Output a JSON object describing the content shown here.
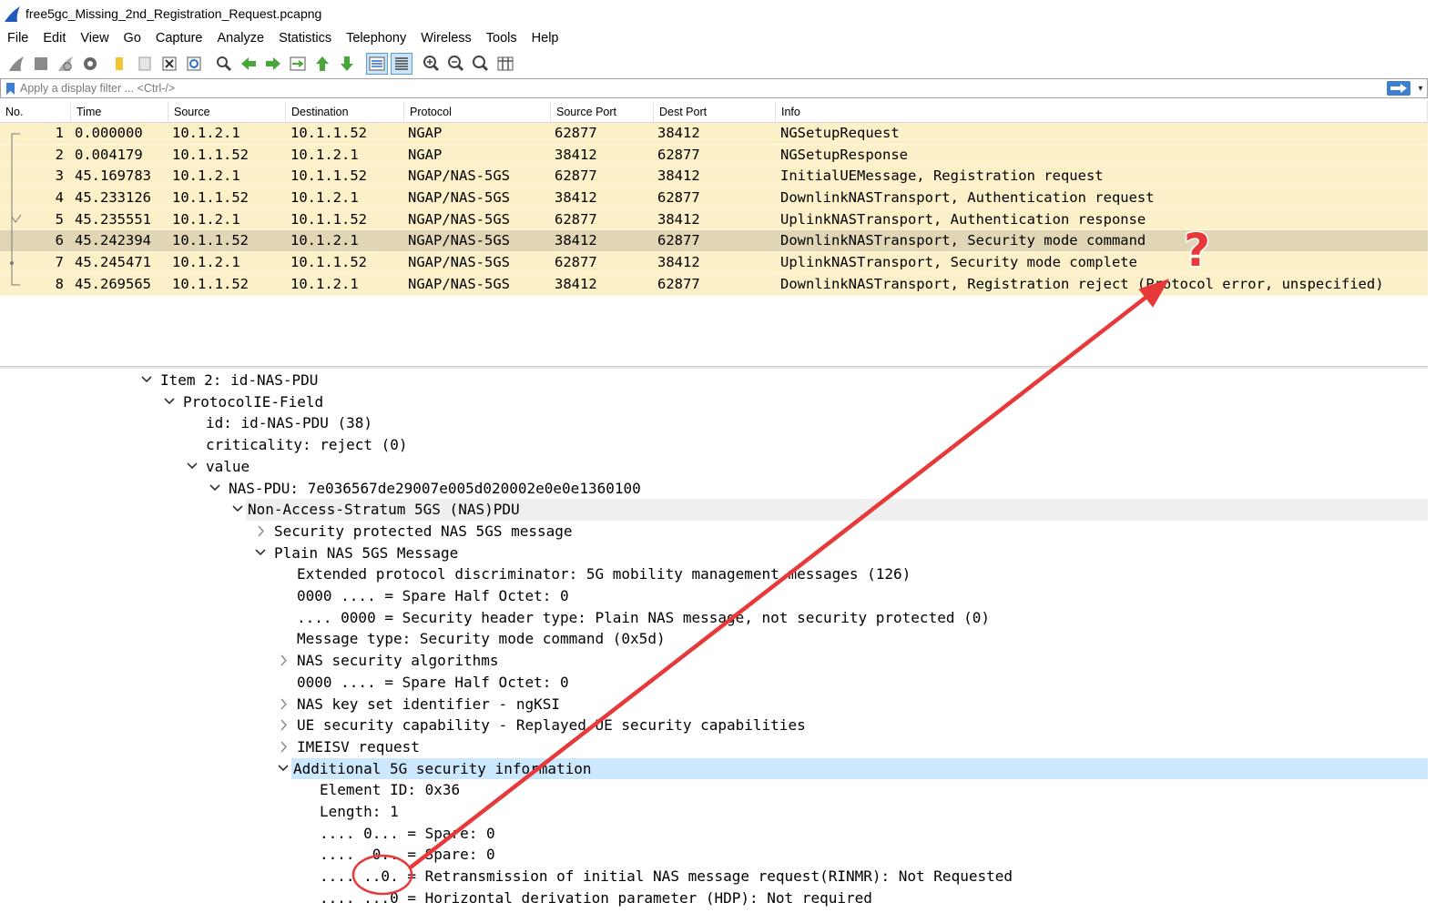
{
  "window": {
    "title": "free5gc_Missing_2nd_Registration_Request.pcapng"
  },
  "menu": [
    "File",
    "Edit",
    "View",
    "Go",
    "Capture",
    "Analyze",
    "Statistics",
    "Telephony",
    "Wireless",
    "Tools",
    "Help"
  ],
  "toolbar": {
    "icons": [
      "shark-fin-start-icon",
      "stop-icon",
      "restart-icon",
      "capture-options-icon",
      "open-file-icon",
      "save-file-icon",
      "close-file-icon",
      "reload-icon",
      "find-packet-icon",
      "go-back-icon",
      "go-forward-icon",
      "go-to-packet-icon",
      "first-packet-icon",
      "last-packet-icon",
      "autoscroll-icon",
      "colorize-icon",
      "zoom-in-icon",
      "zoom-out-icon",
      "zoom-normal-icon",
      "resize-columns-icon"
    ]
  },
  "filter": {
    "placeholder": "Apply a display filter ... <Ctrl-/>"
  },
  "packet_list": {
    "columns": [
      "No.",
      "Time",
      "Source",
      "Destination",
      "Protocol",
      "Source Port",
      "Dest Port",
      "Info"
    ],
    "rows": [
      {
        "no": "1",
        "time": "0.000000",
        "source": "10.1.2.1",
        "destination": "10.1.1.52",
        "protocol": "NGAP",
        "sport": "62877",
        "dport": "38412",
        "info": "NGSetupRequest",
        "selected": false
      },
      {
        "no": "2",
        "time": "0.004179",
        "source": "10.1.1.52",
        "destination": "10.1.2.1",
        "protocol": "NGAP",
        "sport": "38412",
        "dport": "62877",
        "info": "NGSetupResponse",
        "selected": false
      },
      {
        "no": "3",
        "time": "45.169783",
        "source": "10.1.2.1",
        "destination": "10.1.1.52",
        "protocol": "NGAP/NAS-5GS",
        "sport": "62877",
        "dport": "38412",
        "info": "InitialUEMessage, Registration request",
        "selected": false
      },
      {
        "no": "4",
        "time": "45.233126",
        "source": "10.1.1.52",
        "destination": "10.1.2.1",
        "protocol": "NGAP/NAS-5GS",
        "sport": "38412",
        "dport": "62877",
        "info": "DownlinkNASTransport, Authentication request",
        "selected": false
      },
      {
        "no": "5",
        "time": "45.235551",
        "source": "10.1.2.1",
        "destination": "10.1.1.52",
        "protocol": "NGAP/NAS-5GS",
        "sport": "62877",
        "dport": "38412",
        "info": "UplinkNASTransport, Authentication response",
        "selected": false
      },
      {
        "no": "6",
        "time": "45.242394",
        "source": "10.1.1.52",
        "destination": "10.1.2.1",
        "protocol": "NGAP/NAS-5GS",
        "sport": "38412",
        "dport": "62877",
        "info": "DownlinkNASTransport, Security mode command",
        "selected": true
      },
      {
        "no": "7",
        "time": "45.245471",
        "source": "10.1.2.1",
        "destination": "10.1.1.52",
        "protocol": "NGAP/NAS-5GS",
        "sport": "62877",
        "dport": "38412",
        "info": "UplinkNASTransport, Security mode complete",
        "selected": false
      },
      {
        "no": "8",
        "time": "45.269565",
        "source": "10.1.1.52",
        "destination": "10.1.2.1",
        "protocol": "NGAP/NAS-5GS",
        "sport": "38412",
        "dport": "62877",
        "info": "DownlinkNASTransport, Registration reject (Protocol error, unspecified)",
        "selected": false
      }
    ]
  },
  "details": [
    {
      "level": 0,
      "toggle": "open",
      "text": "Item 2: id-NAS-PDU",
      "highlight": ""
    },
    {
      "level": 1,
      "toggle": "open",
      "text": "ProtocolIE-Field",
      "highlight": ""
    },
    {
      "level": 2,
      "toggle": "",
      "text": "id: id-NAS-PDU (38)",
      "highlight": ""
    },
    {
      "level": 2,
      "toggle": "",
      "text": "criticality: reject (0)",
      "highlight": ""
    },
    {
      "level": 2,
      "toggle": "open",
      "text": "value",
      "highlight": ""
    },
    {
      "level": 3,
      "toggle": "open",
      "text": "NAS-PDU: 7e036567de29007e005d020002e0e0e1360100",
      "highlight": ""
    },
    {
      "level": 4,
      "toggle": "open",
      "text": "Non-Access-Stratum 5GS (NAS)PDU",
      "highlight": "grey"
    },
    {
      "level": 5,
      "toggle": "closed",
      "text": "Security protected NAS 5GS message",
      "highlight": ""
    },
    {
      "level": 5,
      "toggle": "open",
      "text": "Plain NAS 5GS Message",
      "highlight": ""
    },
    {
      "level": 6,
      "toggle": "",
      "text": "Extended protocol discriminator: 5G mobility management messages (126)",
      "highlight": ""
    },
    {
      "level": 6,
      "toggle": "",
      "text": "0000 .... = Spare Half Octet: 0",
      "highlight": ""
    },
    {
      "level": 6,
      "toggle": "",
      "text": ".... 0000 = Security header type: Plain NAS message, not security protected (0)",
      "highlight": ""
    },
    {
      "level": 6,
      "toggle": "",
      "text": "Message type: Security mode command (0x5d)",
      "highlight": ""
    },
    {
      "level": 6,
      "toggle": "closed",
      "text": "NAS security algorithms",
      "highlight": ""
    },
    {
      "level": 6,
      "toggle": "",
      "text": "0000 .... = Spare Half Octet: 0",
      "highlight": ""
    },
    {
      "level": 6,
      "toggle": "closed",
      "text": "NAS key set identifier - ngKSI",
      "highlight": ""
    },
    {
      "level": 6,
      "toggle": "closed",
      "text": "UE security capability - Replayed UE security capabilities",
      "highlight": ""
    },
    {
      "level": 6,
      "toggle": "closed",
      "text": "IMEISV request",
      "highlight": ""
    },
    {
      "level": 6,
      "toggle": "open",
      "text": "Additional 5G security information",
      "highlight": "blue"
    },
    {
      "level": 7,
      "toggle": "",
      "text": "Element ID: 0x36",
      "highlight": ""
    },
    {
      "level": 7,
      "toggle": "",
      "text": "Length: 1",
      "highlight": ""
    },
    {
      "level": 7,
      "toggle": "",
      "text": ".... 0... = Spare: 0",
      "highlight": ""
    },
    {
      "level": 7,
      "toggle": "",
      "text": ".... .0.. = Spare: 0",
      "highlight": ""
    },
    {
      "level": 7,
      "toggle": "",
      "text": ".... ..0. = Retransmission of initial NAS message request(RINMR): Not Requested",
      "highlight": ""
    },
    {
      "level": 7,
      "toggle": "",
      "text": ".... ...0 = Horizontal derivation parameter (HDP): Not required",
      "highlight": ""
    }
  ],
  "annotation": {
    "mark": "?",
    "color": "#e8393a"
  }
}
